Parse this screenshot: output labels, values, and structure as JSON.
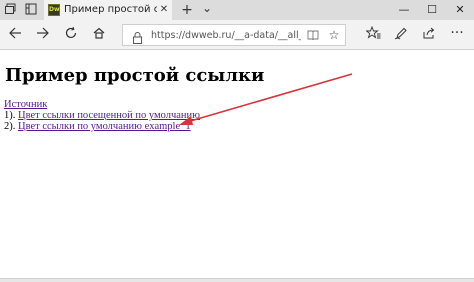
{
  "browser": {
    "tab": {
      "favicon_text": "Dw",
      "title": "Пример простой ссылк",
      "close_label": "✕"
    },
    "new_tab_label": "+",
    "tab_list_label": "⌄",
    "window": {
      "minimize": "—",
      "maximize": "☐",
      "close": "✕"
    },
    "address": {
      "url": "https://dwweb.ru/__a-data/__all_for_scri"
    }
  },
  "page": {
    "title": "Пример простой ссылки",
    "source_link": "Источник",
    "items": [
      {
        "prefix": "1). ",
        "link": "Цвет ссылки посещенной по умолчанию"
      },
      {
        "prefix": "2). ",
        "link": "Цвет ссылки по умолчанию example_1"
      }
    ]
  },
  "annotation": {
    "arrow_color": "#d9343c"
  },
  "colors": {
    "visited_link": "#551a8b",
    "tab_bar": "#dcdcdc",
    "toolbar": "#f2f2f2"
  }
}
